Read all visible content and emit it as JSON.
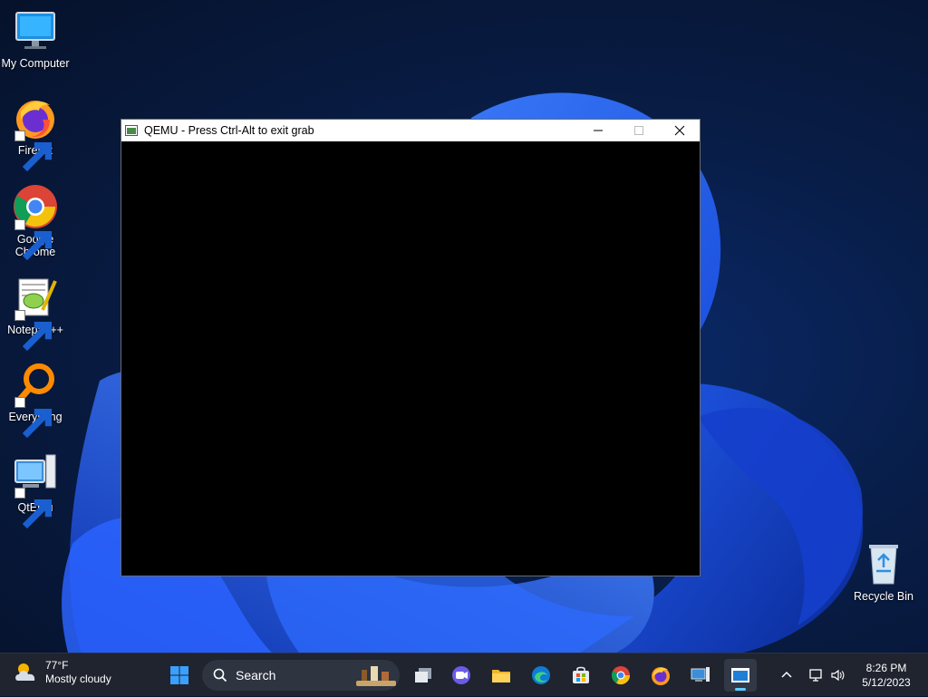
{
  "desktop": {
    "icons": [
      {
        "label": "My Computer"
      },
      {
        "label": "Firefox"
      },
      {
        "label": "Google Chrome"
      },
      {
        "label": "Notepad++"
      },
      {
        "label": "Everything"
      },
      {
        "label": "QtEmu"
      }
    ],
    "recycle_bin": {
      "label": "Recycle Bin"
    }
  },
  "window": {
    "title": "QEMU - Press Ctrl-Alt to exit grab"
  },
  "taskbar": {
    "weather": {
      "temp": "77°F",
      "condition": "Mostly cloudy"
    },
    "search": {
      "label": "Search"
    },
    "clock": {
      "time": "8:26 PM",
      "date": "5/12/2023"
    }
  },
  "colors": {
    "accent": "#60cdff",
    "taskbar": "#1f242f",
    "wallpaper_bloom": "#1f56e8"
  }
}
